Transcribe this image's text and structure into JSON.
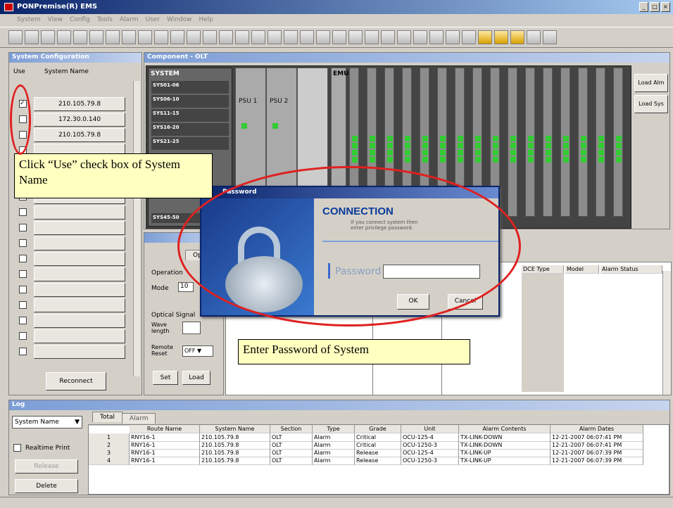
{
  "window": {
    "title": "PONPremise(R) EMS"
  },
  "menu": [
    "System",
    "View",
    "Config",
    "Tools",
    "Alarm",
    "User",
    "Window",
    "Help"
  ],
  "left_panel": {
    "title": "System Configuration",
    "col_use": "Use",
    "col_name": "System Name",
    "systems": [
      {
        "name": "210.105.79.8",
        "checked": true
      },
      {
        "name": "172.30.0.140",
        "checked": false
      },
      {
        "name": "210.105.79.8",
        "checked": false
      }
    ],
    "reconnect_label": "Reconnect"
  },
  "component_panel": {
    "title": "Component - OLT",
    "load_alm": "Load Alm",
    "load_sys": "Load Sys",
    "system_header": "SYSTEM",
    "ranges": [
      "SYS01-06",
      "SYS06-10",
      "SYS11-15",
      "SYS16-20",
      "SYS21-25",
      "SYS45-50"
    ],
    "psu1": "PSU 1",
    "psu2": "PSU 2",
    "emu": "EMU"
  },
  "optical_panel": {
    "tab": "Opt",
    "operation": "Operation",
    "mode_label": "Mode",
    "mode_value": "10",
    "optical_signal": "Optical Signal",
    "wave_length": "Wave length",
    "remote_reset": "Remote Reset",
    "reset_value": "OFF",
    "set_label": "Set",
    "load_label": "Load"
  },
  "info_grid": {
    "headers": [
      "DCE Type",
      "Model",
      "Alarm Status"
    ]
  },
  "dialog": {
    "title": "Password",
    "heading": "CONNECTION",
    "subtitle": "If you connect system then enter privilege password.",
    "password_label": "Password",
    "password_value": "",
    "ok": "OK",
    "cancel": "Cancel"
  },
  "callouts": {
    "use_checkbox": "Click “Use” check box of System Name",
    "enter_password": "Enter Password of  System"
  },
  "log_panel": {
    "title": "Log",
    "filter_value": "System Name",
    "tab_total": "Total",
    "tab_alarm": "Alarm",
    "realtime_label": "Realtime Print",
    "release_label": "Release",
    "delete_label": "Delete",
    "headers": [
      "",
      "Route Name",
      "System Name",
      "Section",
      "Type",
      "Grade",
      "Unit",
      "Alarm Contents",
      "Alarm Dates"
    ],
    "rows": [
      [
        "1",
        "RNY16-1",
        "210.105.79.8",
        "OLT",
        "Alarm",
        "Critical",
        "OCU-125-4",
        "TX-LINK-DOWN",
        "12-21-2007 06:07:41 PM"
      ],
      [
        "2",
        "RNY16-1",
        "210.105.79.8",
        "OLT",
        "Alarm",
        "Critical",
        "OCU-1250-3",
        "TX-LINK-DOWN",
        "12-21-2007 06:07:41 PM"
      ],
      [
        "3",
        "RNY16-1",
        "210.105.79.8",
        "OLT",
        "Alarm",
        "Release",
        "OCU-125-4",
        "TX-LINK-UP",
        "12-21-2007 06:07:39 PM"
      ],
      [
        "4",
        "RNY16-1",
        "210.105.79.8",
        "OLT",
        "Alarm",
        "Release",
        "OCU-1250-3",
        "TX-LINK-UP",
        "12-21-2007 06:07:39 PM"
      ]
    ]
  },
  "colors": {
    "accent_red": "#e02020",
    "titlebar": "#0a246a",
    "led_green": "#33cc33"
  }
}
